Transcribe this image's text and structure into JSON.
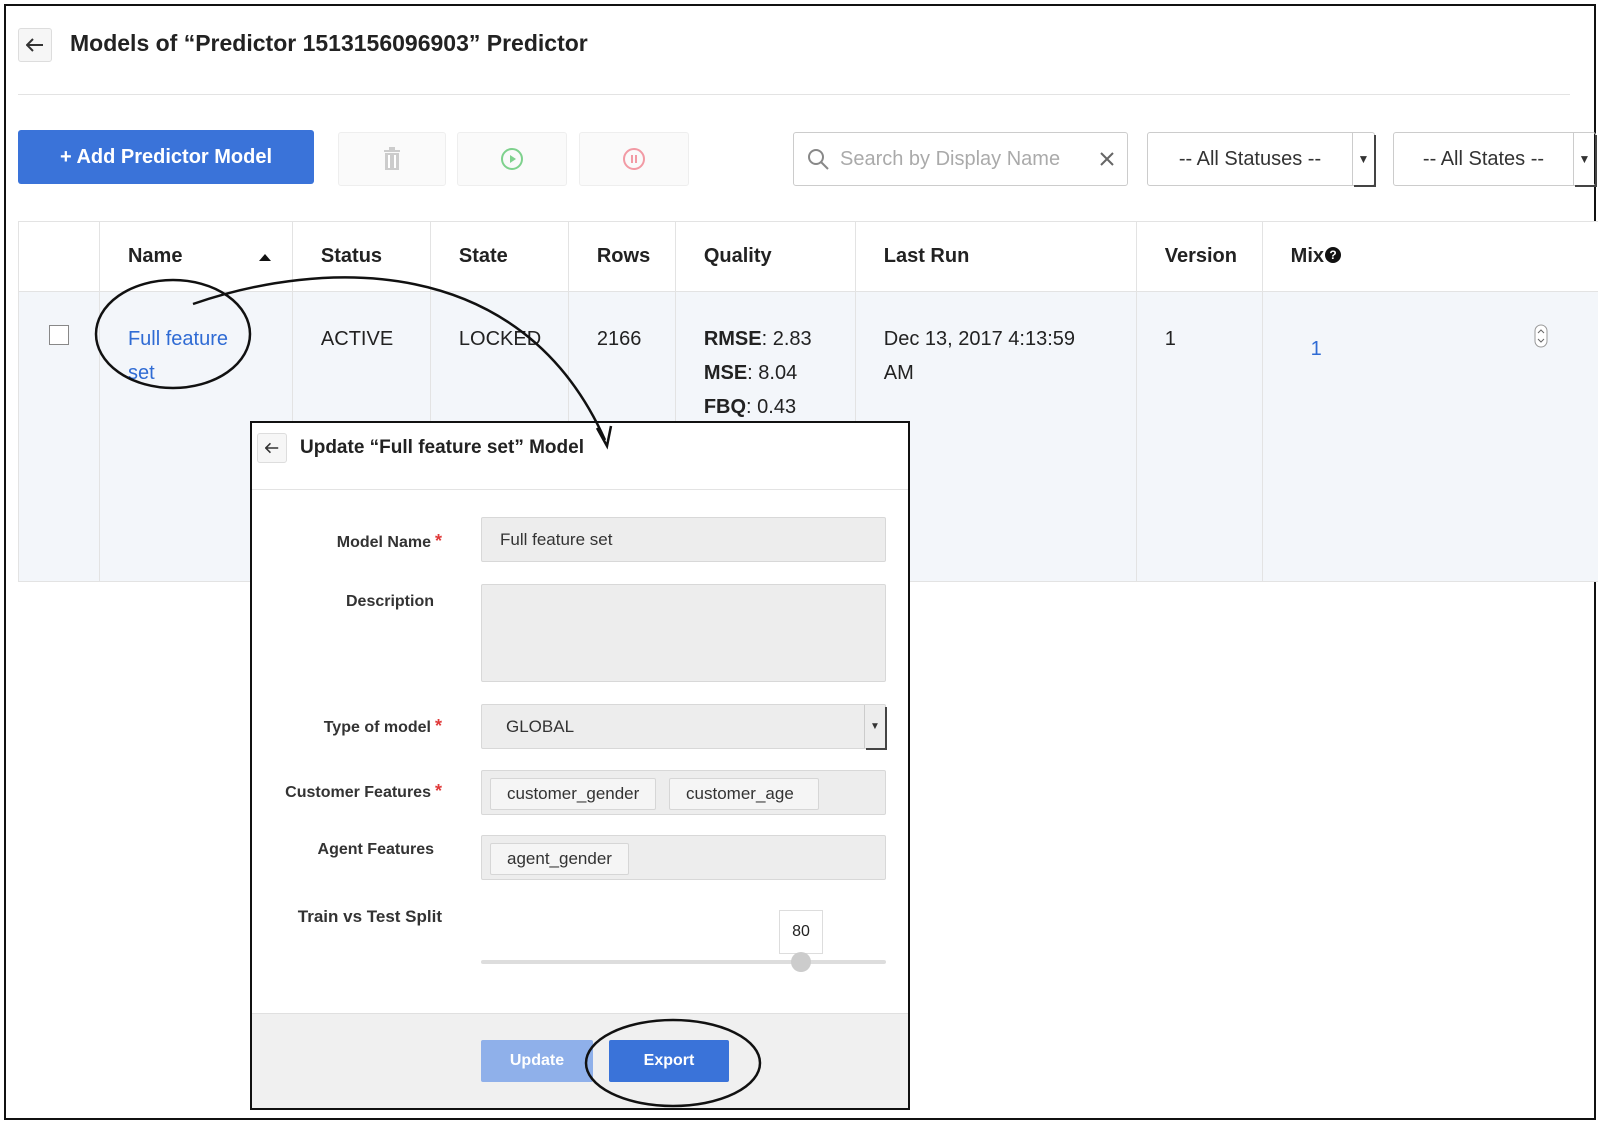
{
  "page": {
    "title": "Models of “Predictor 1513156096903” Predictor"
  },
  "toolbar": {
    "add_label": "+ Add Predictor Model",
    "search_placeholder": "Search by Display Name",
    "status_filter": "-- All Statuses --",
    "state_filter": "-- All States --"
  },
  "table": {
    "columns": [
      "Name",
      "Status",
      "State",
      "Rows",
      "Quality",
      "Last Run",
      "Version",
      "Mix"
    ],
    "rows": [
      {
        "name": "Full feature set",
        "status": "ACTIVE",
        "state": "LOCKED",
        "rows": "2166",
        "quality": [
          {
            "metric": "RMSE",
            "value": ": 2.83"
          },
          {
            "metric": "MSE",
            "value": ": 8.04"
          },
          {
            "metric": "FBQ",
            "value": ": 0.43"
          }
        ],
        "last_run": "Dec 13, 2017 4:13:59 AM",
        "version": "1",
        "mix": "1"
      }
    ]
  },
  "modal": {
    "title": "Update “Full feature set” Model",
    "model_name_label": "Model Name",
    "model_name_value": "Full feature set",
    "description_label": "Description",
    "description_value": "",
    "type_label": "Type of model",
    "type_value": "GLOBAL",
    "customer_features_label": "Customer Features",
    "customer_features": [
      "customer_gender",
      "customer_age"
    ],
    "agent_features_label": "Agent Features",
    "agent_features": [
      "agent_gender"
    ],
    "split_label": "Train vs Test Split",
    "split_value": "80",
    "update_label": "Update",
    "export_label": "Export"
  },
  "colors": {
    "primary": "#3a73d9",
    "link": "#2f6bd4",
    "required": "#e03a3a",
    "disabled_primary": "#8fb0ea"
  }
}
